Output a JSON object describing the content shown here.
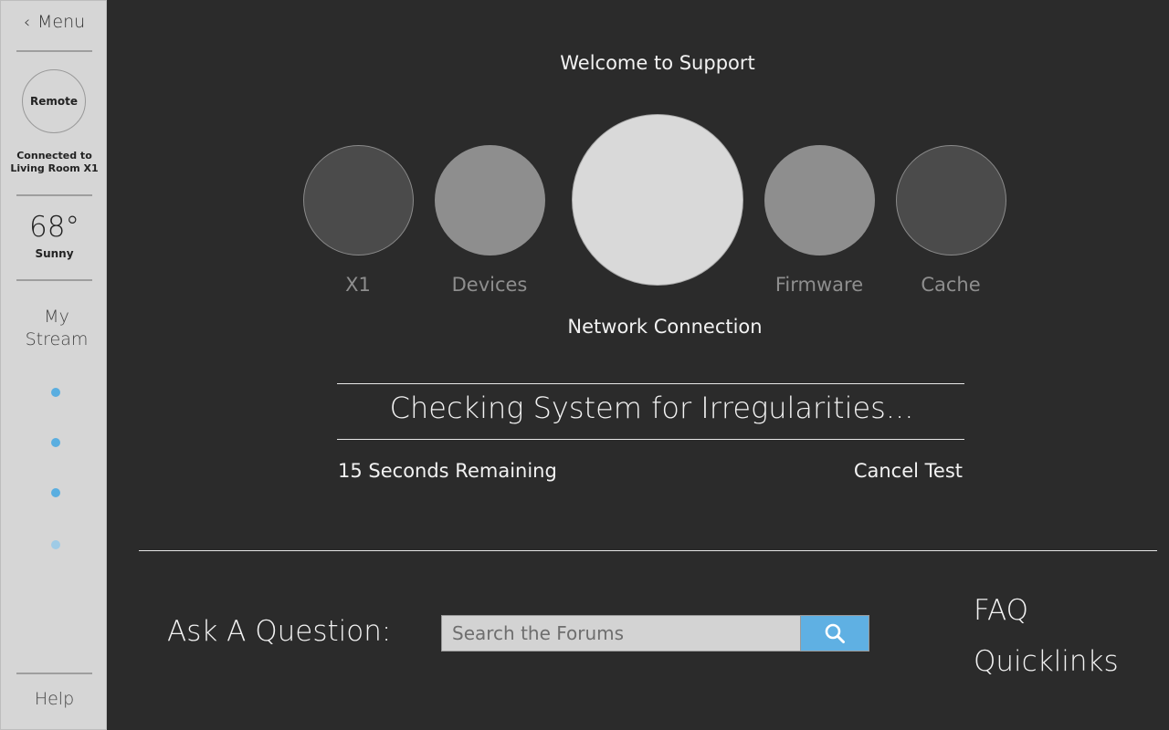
{
  "sidebar": {
    "menu_label": "Menu",
    "remote_label": "Remote",
    "connected_line1": "Connected to",
    "connected_line2": "Living Room X1",
    "temperature": "68°",
    "condition": "Sunny",
    "stream_line1": "My",
    "stream_line2": "Stream",
    "help_label": "Help"
  },
  "main": {
    "welcome": "Welcome to Support",
    "steps": {
      "x1": "X1",
      "devices": "Devices",
      "network": "Network Connection",
      "firmware": "Firmware",
      "cache": "Cache"
    },
    "status_text": "Checking System for Irregularities...",
    "remaining_text": "15 Seconds Remaining",
    "cancel_label": "Cancel Test"
  },
  "footer": {
    "ask_label": "Ask A Question:",
    "search_placeholder": "Search the Forums",
    "faq_label": "FAQ",
    "quicklinks_label": "Quicklinks"
  },
  "colors": {
    "background": "#2b2b2b",
    "sidebar": "#d6d6d6",
    "accent": "#5fb0e3"
  }
}
